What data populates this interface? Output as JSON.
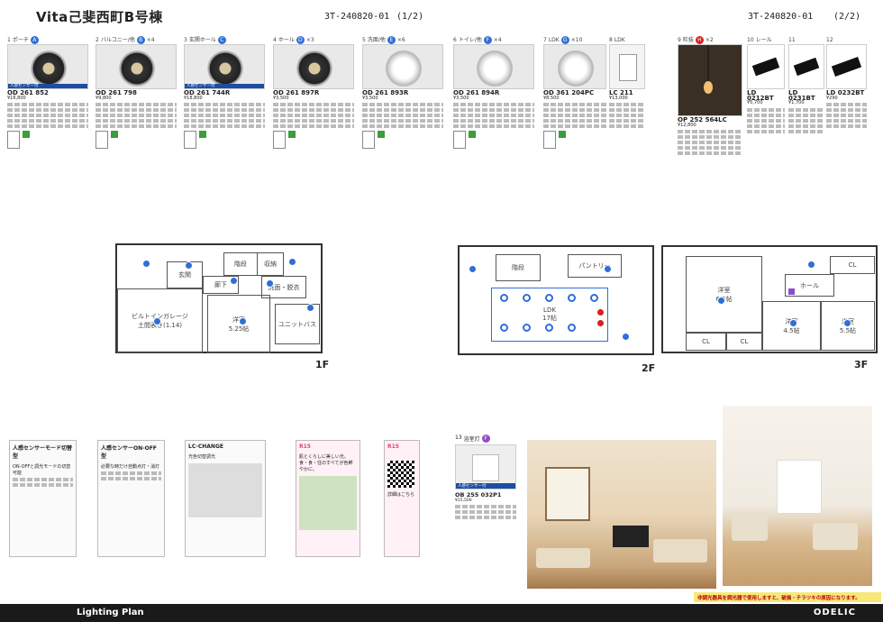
{
  "header": {
    "title": "Vita己斐西町B号棟",
    "code_left": "3T-240820-01",
    "page_left": "(1/2)",
    "code_right": "3T-240820-01",
    "page_right": "(2/2)"
  },
  "products": [
    {
      "no": "1",
      "place": "ポーチ",
      "badge": "A",
      "badge_color": "#2f6fd6",
      "qty": "",
      "code": "OD 261 852",
      "price": "¥16,800",
      "sensor": "人感センサー付",
      "style": "dark"
    },
    {
      "no": "2",
      "place": "バルコニー/他",
      "badge": "B",
      "badge_color": "#2f6fd6",
      "qty": "×4",
      "code": "OD 261 798",
      "price": "¥9,800",
      "sensor": "",
      "style": "dark"
    },
    {
      "no": "3",
      "place": "玄関ホール",
      "badge": "C",
      "badge_color": "#2f6fd6",
      "qty": "",
      "code": "OD 261 744R",
      "price": "¥18,800",
      "sensor": "人感センサー付",
      "style": "dark"
    },
    {
      "no": "4",
      "place": "ホール",
      "badge": "D",
      "badge_color": "#2f6fd6",
      "qty": "×3",
      "code": "OD 261 897R",
      "price": "¥3,500",
      "sensor": "",
      "style": "dark"
    },
    {
      "no": "5",
      "place": "洗面/他",
      "badge": "E",
      "badge_color": "#2f6fd6",
      "qty": "×6",
      "code": "OD 261 893R",
      "price": "¥3,500",
      "sensor": "",
      "style": "white"
    },
    {
      "no": "6",
      "place": "トイレ/他",
      "badge": "F",
      "badge_color": "#2f6fd6",
      "qty": "×4",
      "code": "OD 261 894R",
      "price": "¥3,500",
      "sensor": "",
      "style": "white"
    },
    {
      "no": "7",
      "place": "LDK",
      "badge": "G",
      "badge_color": "#2f6fd6",
      "qty": "×10",
      "code": "OD 361 204PC",
      "price": "¥8,500",
      "sensor": "",
      "style": "white"
    },
    {
      "no": "8",
      "place": "LDK",
      "badge": "",
      "badge_color": "",
      "qty": "",
      "code": "LC 211",
      "price": "¥13,000",
      "sensor": "",
      "style": "switch"
    },
    {
      "no": "9",
      "place": "吹抜",
      "badge": "H",
      "badge_color": "#d62020",
      "qty": "×2",
      "code": "OP 252 564LC",
      "price": "¥12,800",
      "sensor": "",
      "style": "pendant"
    },
    {
      "no": "10",
      "place": "レール",
      "badge": "",
      "badge_color": "",
      "qty": "",
      "code": "LD 0212BT",
      "price": "¥5,700",
      "sensor": "",
      "style": "rail"
    },
    {
      "no": "11",
      "place": "",
      "badge": "",
      "badge_color": "",
      "qty": "",
      "code": "LD 0231BT",
      "price": "¥1,700",
      "sensor": "",
      "style": "rail"
    },
    {
      "no": "12",
      "place": "",
      "badge": "",
      "badge_color": "",
      "qty": "",
      "code": "LD 0232BT",
      "price": "¥290",
      "sensor": "",
      "style": "rail"
    }
  ],
  "plan_1f": {
    "rooms": [
      "玄関",
      "収納",
      "階段",
      "ビルトインガレージ",
      "土間表き(1.14)",
      "廊下",
      "洗面・脱衣",
      "洋室",
      "5.25帖",
      "ユニットバス"
    ],
    "label": "1F"
  },
  "plan_2f": {
    "rooms": [
      "階段",
      "パントリー",
      "LDK",
      "17帖"
    ],
    "label": "2F"
  },
  "plan_3f": {
    "rooms": [
      "CL",
      "ホール",
      "洋室",
      "6.5帖",
      "洋室",
      "4.5帖",
      "洋室",
      "5.5帖",
      "CL",
      "CL"
    ],
    "label": "3F"
  },
  "docs": [
    {
      "title": "人感センサーモード切替型",
      "sub": "ON-OFFと調光モードの切替可能"
    },
    {
      "title": "人感センサーON-OFF型",
      "sub": "必要な時だけ自動点灯・消灯"
    },
    {
      "title": "LC-CHANGE",
      "sub": "光色切替調光"
    },
    {
      "title": "R15",
      "sub": "肌とくらしに美しい光。食・食・住のすべてが色鮮やかに。"
    },
    {
      "title": "R15",
      "sub": "詳細はこちら"
    }
  ],
  "product13": {
    "no": "13",
    "place": "浴室灯",
    "badge": "F",
    "code": "OB 255 032P1",
    "price": "¥15,500",
    "sensor": "人感センサー付"
  },
  "footer": {
    "left": "Lighting Plan",
    "right": "ODELIC",
    "warning": "非調光器具を調光器で使用しますと、破損・チラツキの原因になります。"
  }
}
